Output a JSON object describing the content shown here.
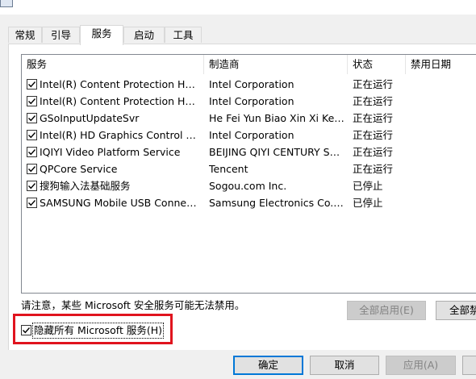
{
  "tabs": [
    {
      "label": "常规"
    },
    {
      "label": "引导"
    },
    {
      "label": "服务"
    },
    {
      "label": "启动"
    },
    {
      "label": "工具"
    }
  ],
  "active_tab": "服务",
  "columns": {
    "service": "服务",
    "manufacturer": "制造商",
    "status": "状态",
    "disabled_date": "禁用日期"
  },
  "services": [
    {
      "name": "Intel(R) Content Protection HECI ...",
      "manufacturer": "Intel Corporation",
      "status": "正在运行",
      "checked": true
    },
    {
      "name": "Intel(R) Content Protection HDCP...",
      "manufacturer": "Intel Corporation",
      "status": "正在运行",
      "checked": true
    },
    {
      "name": "GSoInputUpdateSvr",
      "manufacturer": "He Fei Yun Biao Xin Xi Ke J...",
      "status": "正在运行",
      "checked": true
    },
    {
      "name": "Intel(R) HD Graphics Control Pan...",
      "manufacturer": "Intel Corporation",
      "status": "正在运行",
      "checked": true
    },
    {
      "name": "IQIYI Video Platform Service",
      "manufacturer": "BEIJING QIYI CENTURY SC...",
      "status": "正在运行",
      "checked": true
    },
    {
      "name": "QPCore Service",
      "manufacturer": "Tencent",
      "status": "正在运行",
      "checked": true
    },
    {
      "name": "搜狗输入法基础服务",
      "manufacturer": "Sogou.com Inc.",
      "status": "已停止",
      "checked": true
    },
    {
      "name": "SAMSUNG Mobile USB Connecti...",
      "manufacturer": "Samsung Electronics Co., L...",
      "status": "已停止",
      "checked": true
    }
  ],
  "notice": "请注意，某些 Microsoft 安全服务可能无法禁用。",
  "buttons": {
    "enable_all": "全部启用(E)",
    "disable_all": "全部禁",
    "ok": "确定",
    "cancel": "取消",
    "apply": "应用(A)"
  },
  "hide_microsoft": {
    "label": "隐藏所有 Microsoft 服务(H)",
    "checked": true
  },
  "colors": {
    "highlight": "#e0141e",
    "default_button_border": "#0078d7"
  }
}
